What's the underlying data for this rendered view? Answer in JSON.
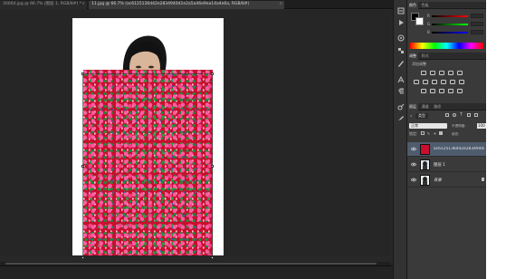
{
  "document_tabs": [
    {
      "label": "30004.jpg @ 66.7% (图层 1, RGB/8#) *",
      "active": false
    },
    {
      "label": "11.jpg @ 66.7% (ac6125136d42e2834940d1e2a5a46e9ea14a4e6a, RGB/8#)",
      "active": true
    }
  ],
  "close_glyph": "×",
  "icon_strip": {
    "icons": [
      "history-icon",
      "play-icon",
      "adjust-icon",
      "swatches-icon",
      "brush-icon",
      "character-icon",
      "paragraph-icon",
      "clone-icon",
      "tool-preset-icon"
    ]
  },
  "color_panel": {
    "tabs": [
      "颜色",
      "色板"
    ],
    "channels": [
      "R",
      "G",
      "B"
    ],
    "channel_colors": [
      "#c03030",
      "#30a030",
      "#3050c0"
    ],
    "foreground": "#000000",
    "background": "#ffffff"
  },
  "adjustments_panel": {
    "tabs": [
      "调整",
      "样式"
    ],
    "title": "添加调整"
  },
  "layers_panel": {
    "tabs": [
      "图层",
      "通道",
      "路径"
    ],
    "kind_filter": "类型",
    "blend_mode": "正常",
    "opacity_label": "不透明度:",
    "opacity_value": "100",
    "lock_label": "锁定:",
    "fill_label": "填充:",
    "layers": [
      {
        "name": "ac6125136d42e2834940d1e2a5a46e9ea14a4e6a",
        "selected": true,
        "italic": false,
        "thumb_color": "#c8102e"
      },
      {
        "name": "图层 1",
        "selected": false,
        "italic": false,
        "thumb_color": "#dfe6ee"
      },
      {
        "name": "背景",
        "selected": false,
        "italic": true,
        "thumb_color": "#e8eaec"
      }
    ]
  }
}
